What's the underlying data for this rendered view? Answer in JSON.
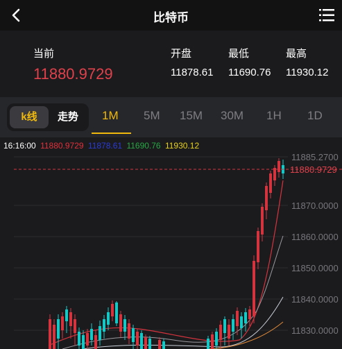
{
  "header": {
    "title": "比特币",
    "back_icon": "chevron-left-icon",
    "menu_icon": "list-menu-icon"
  },
  "quote": {
    "current_label": "当前",
    "current_price": "11880.9729",
    "open_label": "开盘",
    "open_value": "11878.61",
    "low_label": "最低",
    "low_value": "11690.76",
    "high_label": "最高",
    "high_value": "11930.12"
  },
  "periods": {
    "kline_label": "k线",
    "trend_label": "走势",
    "tabs": [
      "1M",
      "5M",
      "15M",
      "30M",
      "1H",
      "1D"
    ],
    "active_tab": "1M"
  },
  "ohlc": {
    "time": "16:16:00",
    "values": [
      "11880.9729",
      "11878.61",
      "11690.76",
      "11930.12"
    ],
    "colors": [
      "#e0313c",
      "#2b3bd6",
      "#27a845",
      "#e8d21a"
    ]
  },
  "chart_data": {
    "type": "candlestick",
    "y_ticks": [
      "11885.2700",
      "11870.0000",
      "11860.0000",
      "11850.0000",
      "11840.0000",
      "11830.0000"
    ],
    "current_price_label": "11880.9729",
    "up_color": "#16c7c6",
    "down_color": "#d4343e",
    "ylim": [
      11826,
      11888
    ]
  }
}
